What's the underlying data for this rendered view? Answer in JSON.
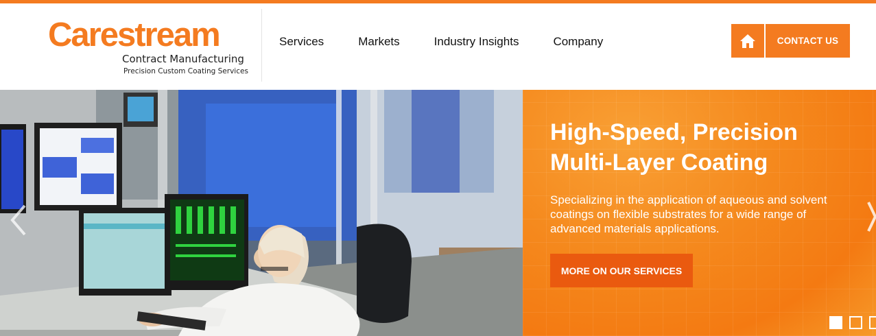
{
  "brand": {
    "name": "Carestream",
    "subtitle": "Contract Manufacturing",
    "tagline": "Precision Custom Coating Services",
    "color": "#f47b20"
  },
  "nav": {
    "items": [
      {
        "label": "Services"
      },
      {
        "label": "Markets"
      },
      {
        "label": "Industry Insights"
      },
      {
        "label": "Company"
      }
    ]
  },
  "header_actions": {
    "home_icon": "home-icon",
    "contact_label": "CONTACT US"
  },
  "hero": {
    "title": "High-Speed, Precision Multi-Layer Coating",
    "description": "Specializing in the application of aqueous and solvent coatings on flexible substrates for a wide range of advanced materials applications.",
    "cta_label": "MORE ON OUR SERVICES",
    "slide_count": 3,
    "active_slide": 1,
    "prev_icon": "chevron-left-icon",
    "next_icon": "chevron-right-icon"
  },
  "colors": {
    "accent": "#f47b20",
    "cta": "#ea5a0f"
  }
}
